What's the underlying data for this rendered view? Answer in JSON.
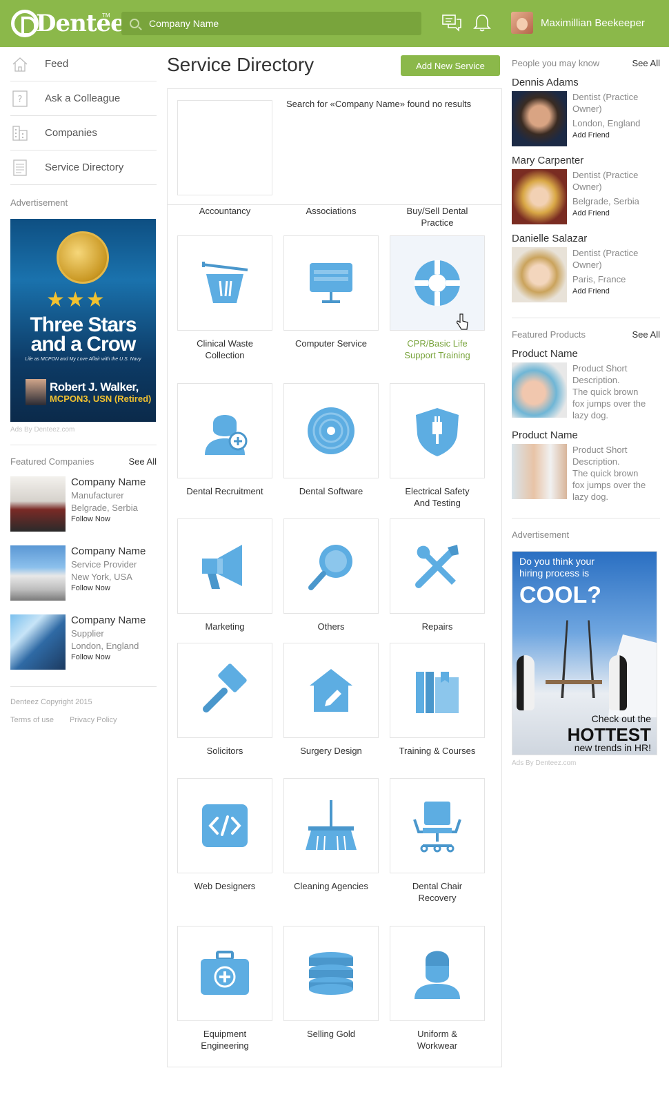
{
  "header": {
    "logo_text": "Denteez",
    "logo_tm": "TM",
    "search_value": "Company Name",
    "user_name": "Maximillian Beekeeper"
  },
  "sidebar": {
    "nav": [
      {
        "label": "Feed",
        "icon": "home-icon"
      },
      {
        "label": "Ask a Colleague",
        "icon": "question-icon"
      },
      {
        "label": "Companies",
        "icon": "building-icon"
      },
      {
        "label": "Service Directory",
        "icon": "document-icon"
      }
    ],
    "ad_heading": "Advertisement",
    "ad": {
      "stars": "★★★",
      "title_line1": "Three Stars",
      "title_line2": "and a Crow",
      "subtitle": "Life as MCPON and My Love Affair with the U.S. Navy",
      "name": "Robert J. Walker,",
      "rank": "MCPON3, USN (Retired)"
    },
    "ads_by": "Ads By Denteez.com",
    "featured_heading": "Featured Companies",
    "featured_see_all": "See All",
    "companies": [
      {
        "name": "Company Name",
        "type": "Manufacturer",
        "location": "Belgrade, Serbia",
        "action": "Follow Now"
      },
      {
        "name": "Company Name",
        "type": "Service Provider",
        "location": "New York, USA",
        "action": "Follow Now"
      },
      {
        "name": "Company Name",
        "type": "Supplier",
        "location": "London, England",
        "action": "Follow Now"
      }
    ],
    "copyright": "Denteez Copyright 2015",
    "terms": "Terms of use",
    "privacy": "Privacy Policy"
  },
  "main": {
    "title": "Service Directory",
    "add_button": "Add New Service",
    "no_results": "Search for «Company Name» found no results",
    "first_row_labels": [
      "Accountancy",
      "Associations",
      "Buy/Sell Dental\nPractice"
    ],
    "categories": [
      {
        "label": "Clinical Waste\nCollection",
        "icon": "waste-basket-icon"
      },
      {
        "label": "Computer Service",
        "icon": "monitor-icon"
      },
      {
        "label": "CPR/Basic Life\nSupport Training",
        "icon": "lifebuoy-icon",
        "active": true
      },
      {
        "label": "Dental Recruitment",
        "icon": "person-add-icon"
      },
      {
        "label": "Dental Software",
        "icon": "disc-icon"
      },
      {
        "label": "Electrical Safety\nAnd Testing",
        "icon": "shield-plug-icon"
      },
      {
        "label": "Marketing",
        "icon": "megaphone-icon"
      },
      {
        "label": "Others",
        "icon": "magnifier-icon"
      },
      {
        "label": "Repairs",
        "icon": "tools-icon"
      },
      {
        "label": "Solicitors",
        "icon": "gavel-icon"
      },
      {
        "label": "Surgery Design",
        "icon": "house-pencil-icon"
      },
      {
        "label": "Training & Courses",
        "icon": "books-icon"
      },
      {
        "label": "Web Designers",
        "icon": "code-icon"
      },
      {
        "label": "Cleaning Agencies",
        "icon": "broom-icon"
      },
      {
        "label": "Dental  Chair\nRecovery",
        "icon": "chair-icon"
      },
      {
        "label": "Equipment\nEngineering",
        "icon": "medical-case-icon"
      },
      {
        "label": "Selling Gold",
        "icon": "coins-icon"
      },
      {
        "label": "Uniform &\nWorkwear",
        "icon": "surgeon-icon"
      }
    ]
  },
  "right": {
    "people_heading": "People you may know",
    "people_see_all": "See All",
    "people": [
      {
        "name": "Dennis Adams",
        "role1": "Dentist (Practice",
        "role2": "Owner)",
        "location": "London, England",
        "action": "Add Friend"
      },
      {
        "name": "Mary Carpenter",
        "role1": "Dentist (Practice",
        "role2": "Owner)",
        "location": "Belgrade, Serbia",
        "action": "Add Friend"
      },
      {
        "name": "Danielle Salazar",
        "role1": "Dentist (Practice",
        "role2": "Owner)",
        "location": "Paris, France",
        "action": "Add Friend"
      }
    ],
    "products_heading": "Featured Products",
    "products_see_all": "See All",
    "products": [
      {
        "name": "Product Name",
        "lines": [
          "Product Short",
          "Description.",
          "The quick brown",
          "fox jumps over the",
          "lazy dog."
        ]
      },
      {
        "name": "Product Name",
        "lines": [
          "Product Short",
          "Description.",
          "The quick brown",
          "fox jumps over the",
          "lazy dog."
        ]
      }
    ],
    "ad_heading": "Advertisement",
    "ad": {
      "question_line1": "Do you think your",
      "question_line2": "hiring process is",
      "cool": "COOL?",
      "check": "Check out the",
      "hottest": "HOTTEST",
      "trends": "new trends in HR!"
    },
    "ads_by": "Ads By Denteez.com"
  },
  "colors": {
    "brand_green": "#8bb84a",
    "icon_blue": "#5dade2",
    "active_label": "#79a43c"
  }
}
